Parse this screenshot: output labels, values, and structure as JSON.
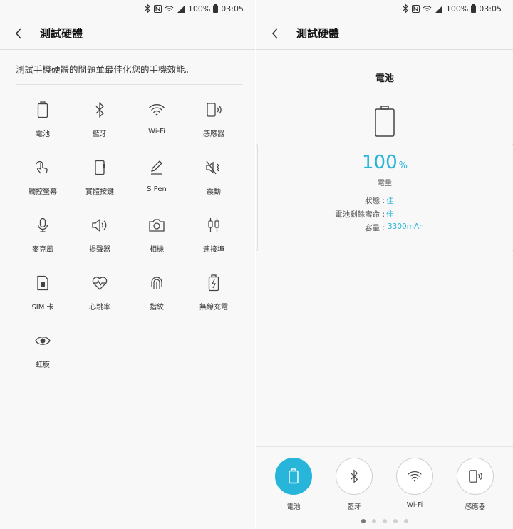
{
  "status": {
    "battery_pct": "100%",
    "time": "03:05"
  },
  "left": {
    "title": "測試硬體",
    "description": "測試手機硬體的問題並最佳化您的手機效能。",
    "items": [
      {
        "label": "電池",
        "icon": "battery-icon"
      },
      {
        "label": "藍牙",
        "icon": "bluetooth-icon"
      },
      {
        "label": "Wi-Fi",
        "icon": "wifi-icon"
      },
      {
        "label": "感應器",
        "icon": "sensor-icon"
      },
      {
        "label": "觸控螢幕",
        "icon": "touch-icon"
      },
      {
        "label": "實體按鍵",
        "icon": "phone-button-icon"
      },
      {
        "label": "S Pen",
        "icon": "pen-icon"
      },
      {
        "label": "震動",
        "icon": "vibration-icon"
      },
      {
        "label": "麥克風",
        "icon": "microphone-icon"
      },
      {
        "label": "揚聲器",
        "icon": "speaker-icon"
      },
      {
        "label": "相機",
        "icon": "camera-icon"
      },
      {
        "label": "連接埠",
        "icon": "port-icon"
      },
      {
        "label": "SIM 卡",
        "icon": "sim-icon"
      },
      {
        "label": "心跳率",
        "icon": "heart-rate-icon"
      },
      {
        "label": "指紋",
        "icon": "fingerprint-icon"
      },
      {
        "label": "無線充電",
        "icon": "wireless-charging-icon"
      },
      {
        "label": "虹膜",
        "icon": "eye-icon"
      }
    ]
  },
  "right": {
    "title": "測試硬體",
    "detail_title": "電池",
    "percent_value": "100",
    "percent_unit": "%",
    "percent_label": "電量",
    "rows": [
      {
        "key": "狀態 : ",
        "value": "佳"
      },
      {
        "key": "電池剩餘壽命 : ",
        "value": "佳"
      },
      {
        "key": "容量 : ",
        "value": "3300mAh"
      }
    ],
    "tabs": [
      {
        "label": "電池",
        "icon": "battery-icon",
        "active": true
      },
      {
        "label": "藍牙",
        "icon": "bluetooth-icon",
        "active": false
      },
      {
        "label": "Wi-Fi",
        "icon": "wifi-icon",
        "active": false
      },
      {
        "label": "感應器",
        "icon": "sensor-icon",
        "active": false
      }
    ],
    "page_dots": {
      "count": 5,
      "active": 1
    }
  },
  "colors": {
    "accent": "#27b6d9",
    "text": "#222222",
    "background": "#f8f8f8"
  }
}
